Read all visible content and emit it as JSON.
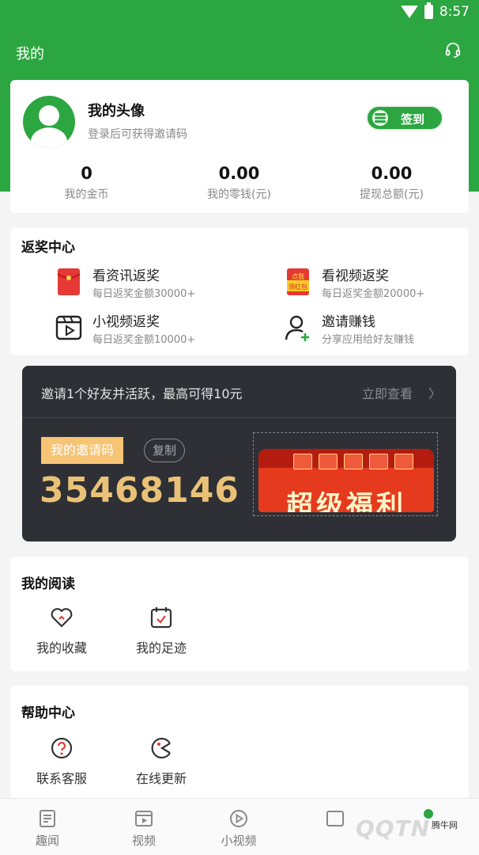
{
  "status": {
    "time": "8:57"
  },
  "appbar": {
    "title": "我的",
    "support_icon": "headset-icon"
  },
  "profile": {
    "nickname": "我的头像",
    "subtitle": "登录后可获得邀请码",
    "signin_label": "签到",
    "stats": [
      {
        "value": "0",
        "label": "我的金币"
      },
      {
        "value": "0.00",
        "label": "我的零钱(元)"
      },
      {
        "value": "0.00",
        "label": "提现总额(元)"
      }
    ]
  },
  "reward": {
    "title": "返奖中心",
    "items": [
      {
        "label": "看资讯返奖",
        "sub": "每日返奖金额30000+",
        "icon": "red-envelope-icon"
      },
      {
        "label": "看视频返奖",
        "sub": "每日返奖金额20000+",
        "icon": "red-packet-video-icon"
      },
      {
        "label": "小视频返奖",
        "sub": "每日返奖金额10000+",
        "icon": "clapper-icon"
      },
      {
        "label": "邀请赚钱",
        "sub": "分享应用给好友赚钱",
        "icon": "add-user-icon"
      }
    ],
    "packet_badge_top": "点我",
    "packet_badge_bottom": "领红包"
  },
  "invite": {
    "headline": "邀请1个好友并活跃，最高可得10元",
    "view_now": "立即查看",
    "arrow": "〉",
    "code_tag": "我的邀请码",
    "copy_label": "复制",
    "code": "35468146",
    "welfare_text": "超级福利"
  },
  "reading": {
    "title": "我的阅读",
    "items": [
      {
        "label": "我的收藏",
        "icon": "heart-icon"
      },
      {
        "label": "我的足迹",
        "icon": "calendar-check-icon"
      }
    ]
  },
  "help": {
    "title": "帮助中心",
    "items": [
      {
        "label": "联系客服",
        "icon": "question-icon"
      },
      {
        "label": "在线更新",
        "icon": "update-icon"
      }
    ]
  },
  "nav": {
    "items": [
      {
        "label": "趣闻",
        "icon": "news-icon"
      },
      {
        "label": "视频",
        "icon": "video-icon"
      },
      {
        "label": "小视频",
        "icon": "play-circle-icon"
      }
    ]
  },
  "watermark": {
    "logo": "QQTN",
    "site": "腾牛网"
  },
  "colors": {
    "brand_green": "#2ca640",
    "banner_dark": "#2f3035",
    "gold": "#e9c278",
    "red": "#e63a1e"
  }
}
